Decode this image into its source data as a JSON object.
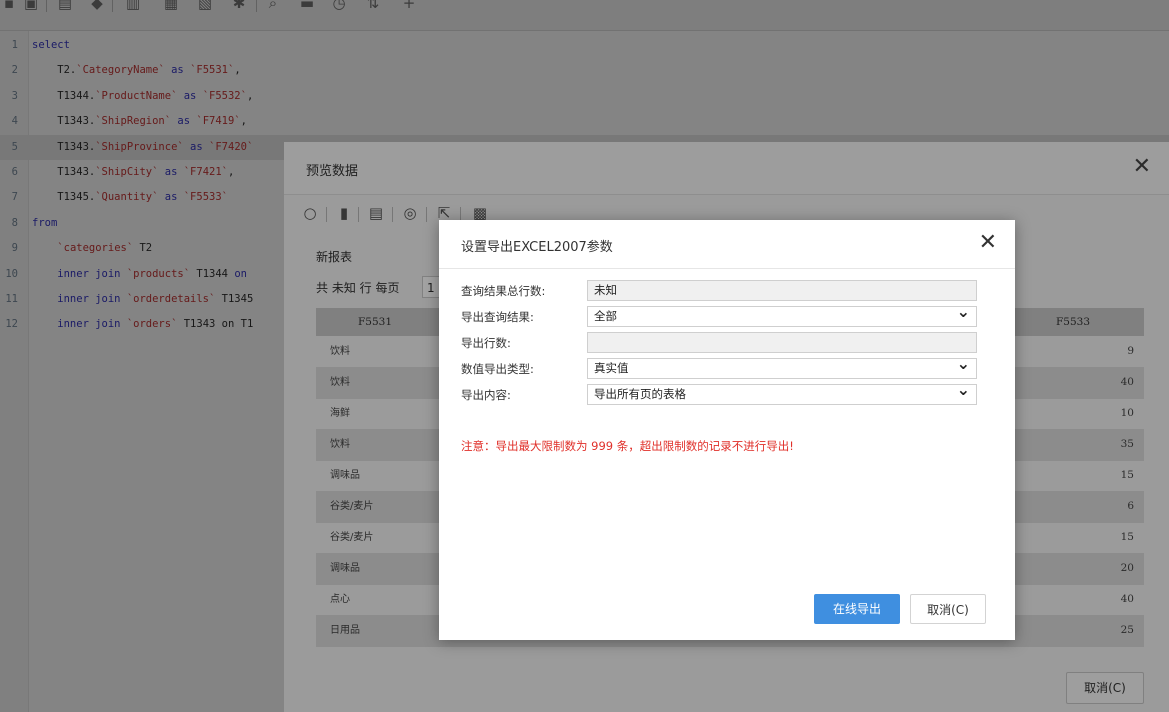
{
  "editor": {
    "lines": [
      {
        "n": "1",
        "parts": [
          {
            "t": "select",
            "c": "kw"
          }
        ]
      },
      {
        "n": "2",
        "parts": [
          {
            "t": "    T2.",
            "c": ""
          },
          {
            "t": "`CategoryName`",
            "c": "str"
          },
          {
            "t": " as ",
            "c": "kw"
          },
          {
            "t": "`F5531`",
            "c": "str"
          },
          {
            "t": ",",
            "c": ""
          }
        ]
      },
      {
        "n": "3",
        "parts": [
          {
            "t": "    T1344.",
            "c": ""
          },
          {
            "t": "`ProductName`",
            "c": "str"
          },
          {
            "t": " as ",
            "c": "kw"
          },
          {
            "t": "`F5532`",
            "c": "str"
          },
          {
            "t": ",",
            "c": ""
          }
        ]
      },
      {
        "n": "4",
        "parts": [
          {
            "t": "    T1343.",
            "c": ""
          },
          {
            "t": "`ShipRegion`",
            "c": "str"
          },
          {
            "t": " as ",
            "c": "kw"
          },
          {
            "t": "`F7419`",
            "c": "str"
          },
          {
            "t": ",",
            "c": ""
          }
        ]
      },
      {
        "n": "5",
        "parts": [
          {
            "t": "    T1343.",
            "c": ""
          },
          {
            "t": "`ShipProvince`",
            "c": "str"
          },
          {
            "t": " as ",
            "c": "kw"
          },
          {
            "t": "`F7420`",
            "c": "str"
          }
        ]
      },
      {
        "n": "6",
        "parts": [
          {
            "t": "    T1343.",
            "c": ""
          },
          {
            "t": "`ShipCity`",
            "c": "str"
          },
          {
            "t": " as ",
            "c": "kw"
          },
          {
            "t": "`F7421`",
            "c": "str"
          },
          {
            "t": ",",
            "c": ""
          }
        ]
      },
      {
        "n": "7",
        "parts": [
          {
            "t": "    T1345.",
            "c": ""
          },
          {
            "t": "`Quantity`",
            "c": "str"
          },
          {
            "t": " as ",
            "c": "kw"
          },
          {
            "t": "`F5533`",
            "c": "str"
          }
        ]
      },
      {
        "n": "8",
        "parts": [
          {
            "t": "from",
            "c": "kw"
          }
        ]
      },
      {
        "n": "9",
        "parts": [
          {
            "t": "    ",
            "c": ""
          },
          {
            "t": "`categories`",
            "c": "str"
          },
          {
            "t": " T2",
            "c": ""
          }
        ]
      },
      {
        "n": "10",
        "parts": [
          {
            "t": "    inner join ",
            "c": "kw"
          },
          {
            "t": "`products`",
            "c": "str"
          },
          {
            "t": " T1344 ",
            "c": ""
          },
          {
            "t": "on",
            "c": "kw"
          }
        ]
      },
      {
        "n": "11",
        "parts": [
          {
            "t": "    inner join ",
            "c": "kw"
          },
          {
            "t": "`orderdetails`",
            "c": "str"
          },
          {
            "t": " T1345",
            "c": ""
          }
        ]
      },
      {
        "n": "12",
        "parts": [
          {
            "t": "    inner join ",
            "c": "kw"
          },
          {
            "t": "`orders`",
            "c": "str"
          },
          {
            "t": " T1343 on T1",
            "c": ""
          }
        ]
      }
    ]
  },
  "preview": {
    "title": "预览数据",
    "report_name": "新报表",
    "pager_text": "共 未知 行   每页",
    "page_size": "1",
    "columns": [
      "F5531",
      "F5533"
    ],
    "rows": [
      {
        "category": "饮料",
        "qty": "9"
      },
      {
        "category": "饮料",
        "qty": "40"
      },
      {
        "category": "海鲜",
        "qty": "10"
      },
      {
        "category": "饮料",
        "qty": "35"
      },
      {
        "category": "调味品",
        "qty": "15"
      },
      {
        "category": "谷类/麦片",
        "qty": "6"
      },
      {
        "category": "谷类/麦片",
        "qty": "15"
      },
      {
        "category": "调味品",
        "qty": "20"
      },
      {
        "category": "点心",
        "qty": "40"
      },
      {
        "category": "日用品",
        "qty": "25"
      }
    ],
    "cancel_label": "取消(C)"
  },
  "export_dialog": {
    "title": "设置导出EXCEL2007参数",
    "fields": {
      "total_rows_label": "查询结果总行数:",
      "total_rows_value": "未知",
      "export_result_label": "导出查询结果:",
      "export_result_value": "全部",
      "export_rows_label": "导出行数:",
      "export_rows_value": "",
      "value_type_label": "数值导出类型:",
      "value_type_value": "真实值",
      "content_label": "导出内容:",
      "content_value": "导出所有页的表格"
    },
    "note": "注意：导出最大限制数为 999 条，超出限制数的记录不进行导出!",
    "export_button": "在线导出",
    "cancel_button": "取消(C)"
  },
  "colors": {
    "primary": "#3f8fe0",
    "warning": "#e0302a"
  }
}
